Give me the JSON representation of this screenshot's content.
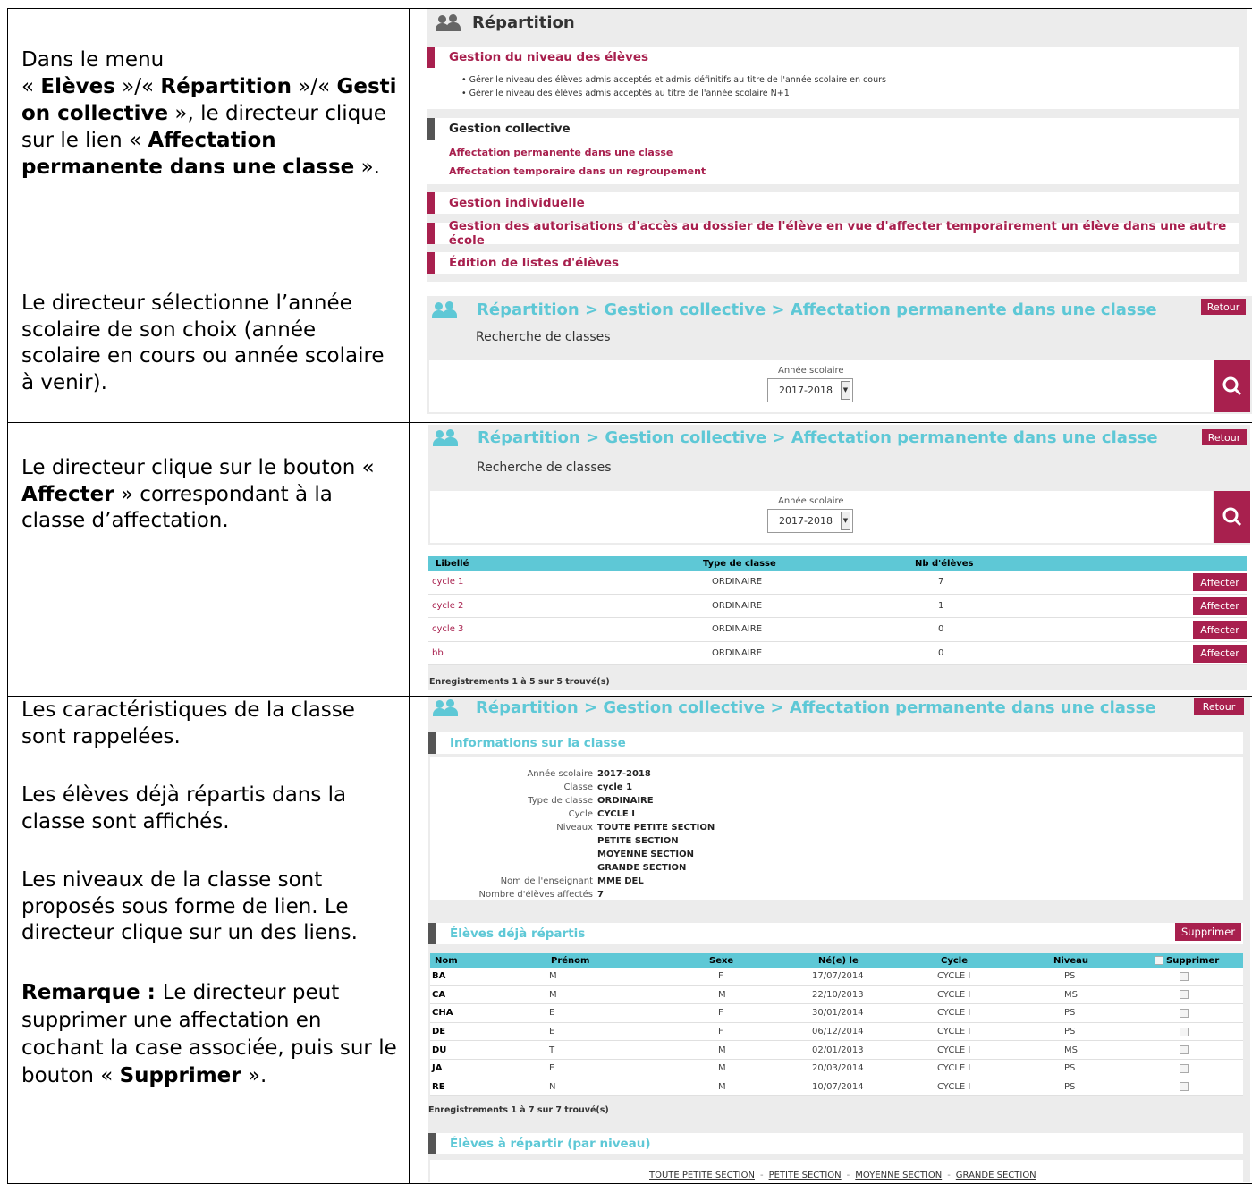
{
  "rows": {
    "r1": {
      "t1": "Dans le menu",
      "t2": "« ",
      "t3": "Elèves",
      "t4": " »/« ",
      "t5": "Répartition",
      "t6": " »/« ",
      "t7": "Gestion collective",
      "t8": " »,  le directeur clique sur le lien « ",
      "t9": "Affectation permanente dans une classe",
      "t10": " »."
    },
    "r2": {
      "t1": "Le directeur sélectionne l’année scolaire de son choix (année scolaire en cours ou année scolaire à venir)."
    },
    "r3": {
      "t1": "Le directeur clique sur le bouton « ",
      "t2": "Affecter",
      "t3": " » correspondant à la classe d’affectation."
    },
    "r4": {
      "p1": "Les caractéristiques de la classe sont rappelées.",
      "p2": "Les élèves déjà répartis dans la classe sont affichés.",
      "p3": "Les niveaux de la classe sont proposés sous forme de lien. Le directeur clique sur un des liens.",
      "p4a": "Remarque : ",
      "p4b": "Le directeur peut supprimer une affectation en cochant la case associée, puis sur le bouton « ",
      "p4c": "Supprimer",
      "p4d": " »."
    }
  },
  "s1": {
    "title": "Répartition",
    "sections": [
      {
        "label": "Gestion du niveau des élèves",
        "color": "#a8204e",
        "bullets": [
          "Gérer le niveau des élèves admis acceptés et admis définitifs au titre de l'année scolaire en cours",
          "Gérer le niveau des élèves admis acceptés au titre de l'année scolaire N+1"
        ]
      },
      {
        "label": "Gestion collective",
        "color": "#333333",
        "links": [
          "Affectation permanente dans une classe",
          "Affectation temporaire dans un regroupement"
        ]
      },
      {
        "label": "Gestion individuelle",
        "color": "#a8204e"
      },
      {
        "label": "Gestion des autorisations d'accès au dossier de l'élève en vue d'affecter temporairement un élève dans une autre école",
        "color": "#a8204e"
      },
      {
        "label": "Édition de listes d'élèves",
        "color": "#a8204e"
      }
    ]
  },
  "common": {
    "breadcrumb": "Répartition > Gestion collective > Affectation permanente dans une classe",
    "back": "Retour",
    "search_title": "Recherche de classes",
    "year_label": "Année scolaire",
    "year_value": "2017-2018"
  },
  "classes": {
    "headers": [
      "Libellé",
      "Type de classe",
      "Nb d'élèves"
    ],
    "rows": [
      {
        "lib": "cycle 1",
        "type": "ORDINAIRE",
        "nb": "7",
        "btn": "Affecter"
      },
      {
        "lib": "cycle 2",
        "type": "ORDINAIRE",
        "nb": "1",
        "btn": "Affecter"
      },
      {
        "lib": "cycle 3",
        "type": "ORDINAIRE",
        "nb": "0",
        "btn": "Affecter"
      },
      {
        "lib": "bb",
        "type": "ORDINAIRE",
        "nb": "0",
        "btn": "Affecter"
      }
    ],
    "footer": "Enregistrements 1 à 5 sur 5 trouvé(s)"
  },
  "info": {
    "title": "Informations sur la classe",
    "fields": [
      {
        "k": "Année scolaire",
        "v": "2017-2018"
      },
      {
        "k": "Classe",
        "v": "cycle 1"
      },
      {
        "k": "Type de classe",
        "v": "ORDINAIRE"
      },
      {
        "k": "Cycle",
        "v": "CYCLE I"
      },
      {
        "k": "Niveaux",
        "v": "TOUTE PETITE SECTION"
      },
      {
        "k": "",
        "v": "PETITE SECTION"
      },
      {
        "k": "",
        "v": "MOYENNE SECTION"
      },
      {
        "k": "",
        "v": "GRANDE SECTION"
      },
      {
        "k": "Nom de l'enseignant",
        "v": "MME DEL"
      },
      {
        "k": "Nombre d'élèves affectés",
        "v": "7"
      }
    ]
  },
  "students": {
    "title": "Élèves déjà répartis",
    "delete": "Supprimer",
    "headers": [
      "Nom",
      "Prénom",
      "Sexe",
      "Né(e) le",
      "Cycle",
      "Niveau",
      "Supprimer"
    ],
    "rows": [
      {
        "nom": "BA",
        "prenom": "M",
        "sexe": "F",
        "date": "17/07/2014",
        "cycle": "CYCLE I",
        "niveau": "PS"
      },
      {
        "nom": "CA",
        "prenom": "M",
        "sexe": "M",
        "date": "22/10/2013",
        "cycle": "CYCLE I",
        "niveau": "MS"
      },
      {
        "nom": "CHA",
        "prenom": "E",
        "sexe": "F",
        "date": "30/01/2014",
        "cycle": "CYCLE I",
        "niveau": "PS"
      },
      {
        "nom": "DE",
        "prenom": "E",
        "sexe": "F",
        "date": "06/12/2014",
        "cycle": "CYCLE I",
        "niveau": "PS"
      },
      {
        "nom": "DU",
        "prenom": "T",
        "sexe": "M",
        "date": "02/01/2013",
        "cycle": "CYCLE I",
        "niveau": "MS"
      },
      {
        "nom": "JA",
        "prenom": "E",
        "sexe": "M",
        "date": "20/03/2014",
        "cycle": "CYCLE I",
        "niveau": "PS"
      },
      {
        "nom": "RE",
        "prenom": "N",
        "sexe": "M",
        "date": "10/07/2014",
        "cycle": "CYCLE I",
        "niveau": "PS"
      }
    ],
    "footer": "Enregistrements 1 à 7 sur 7 trouvé(s)"
  },
  "toassign": {
    "title": "Élèves à répartir (par niveau)",
    "links": [
      "TOUTE PETITE SECTION",
      "PETITE SECTION",
      "MOYENNE SECTION",
      "GRANDE SECTION"
    ],
    "sep": "-"
  },
  "colors": {
    "crimson": "#a8204e",
    "teal": "#5ec8d6",
    "panel": "#ececec"
  }
}
